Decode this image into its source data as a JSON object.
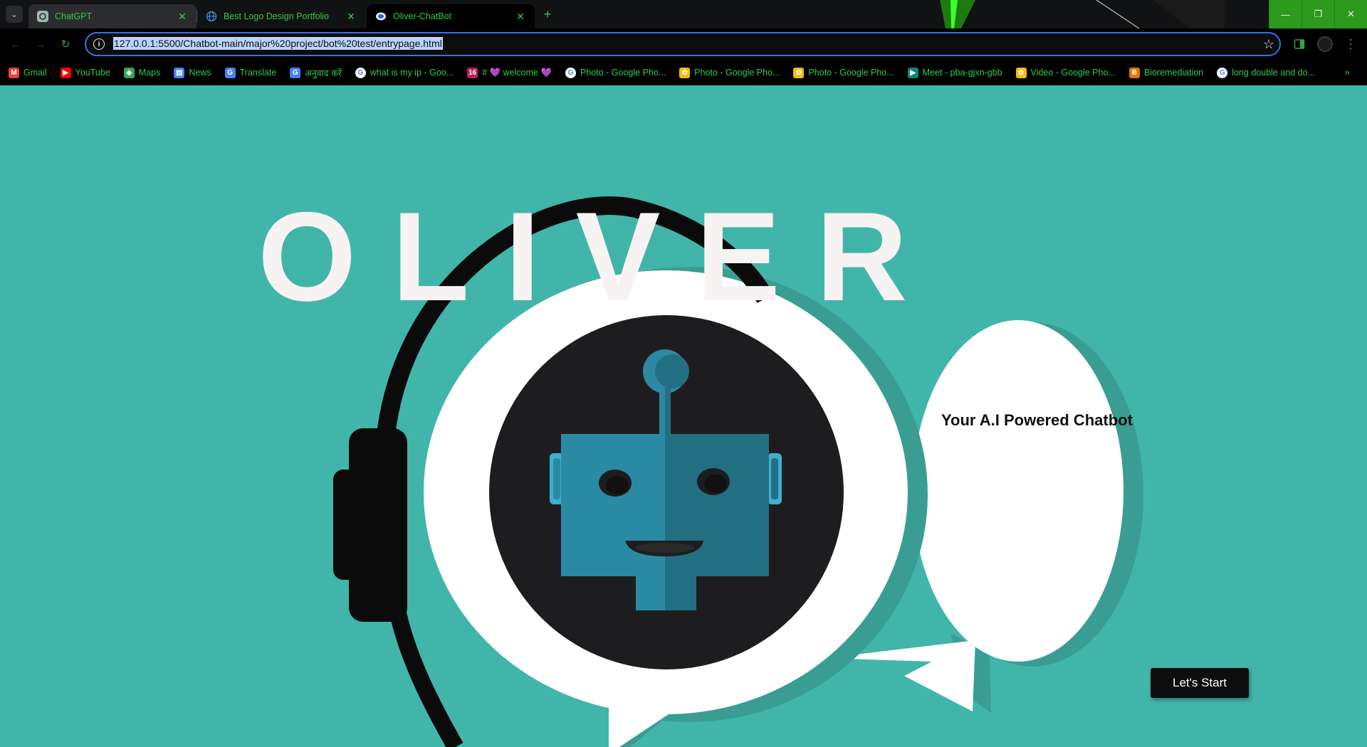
{
  "browser": {
    "tabs": [
      {
        "title": "ChatGPT",
        "icon": "chatgpt-icon",
        "active": false
      },
      {
        "title": "Best Logo Design Portfolio",
        "icon": "globe-icon",
        "active": false
      },
      {
        "title": "Oliver-ChatBot",
        "icon": "chatbot-favicon",
        "active": true
      }
    ],
    "url": "127.0.0.1:5500/Chatbot-main/major%20project/bot%20test/entrypage.html",
    "bookmarks": [
      {
        "label": "Gmail",
        "icon": "gmail-icon",
        "color": "#ea4335",
        "glyph": "M"
      },
      {
        "label": "YouTube",
        "icon": "youtube-icon",
        "color": "#ff0000",
        "glyph": "▶"
      },
      {
        "label": "Maps",
        "icon": "maps-icon",
        "color": "#34a853",
        "glyph": "◆"
      },
      {
        "label": "News",
        "icon": "news-icon",
        "color": "#4285f4",
        "glyph": "▤"
      },
      {
        "label": "Translate",
        "icon": "translate-icon",
        "color": "#4285f4",
        "glyph": "G"
      },
      {
        "label": "अनुवाद करें",
        "icon": "translate-icon",
        "color": "#4285f4",
        "glyph": "G"
      },
      {
        "label": "what is my ip - Goo...",
        "icon": "google-icon",
        "color": "#ffffff",
        "glyph": "G"
      },
      {
        "label": "# 💜 welcome 💜",
        "icon": "calendar-icon",
        "color": "#c2185b",
        "glyph": "16"
      },
      {
        "label": "Photo - Google Pho...",
        "icon": "google-icon",
        "color": "#ffffff",
        "glyph": "G"
      },
      {
        "label": "Photo - Google Pho...",
        "icon": "google-photos-icon",
        "color": "#fbbc05",
        "glyph": "✿"
      },
      {
        "label": "Photo - Google Pho...",
        "icon": "google-photos-icon",
        "color": "#fbbc05",
        "glyph": "✿"
      },
      {
        "label": "Meet - pba-gjxn-gbb",
        "icon": "meet-icon",
        "color": "#00897b",
        "glyph": "▶"
      },
      {
        "label": "Video - Google Pho...",
        "icon": "google-photos-icon",
        "color": "#fbbc05",
        "glyph": "✿"
      },
      {
        "label": "Bioremediation",
        "icon": "bookmark-icon",
        "color": "#e37400",
        "glyph": "B"
      },
      {
        "label": "long double and do...",
        "icon": "google-icon",
        "color": "#ffffff",
        "glyph": "G"
      }
    ]
  },
  "page": {
    "title": "OLIVER",
    "tagline": "Your A.I Powered Chatbot",
    "start_label": "Let's Start"
  },
  "colors": {
    "background": "#42b5ab",
    "robot_blue": "#2b8aa3",
    "robot_dark": "#1d1d1f",
    "accent_green": "#35c948"
  }
}
